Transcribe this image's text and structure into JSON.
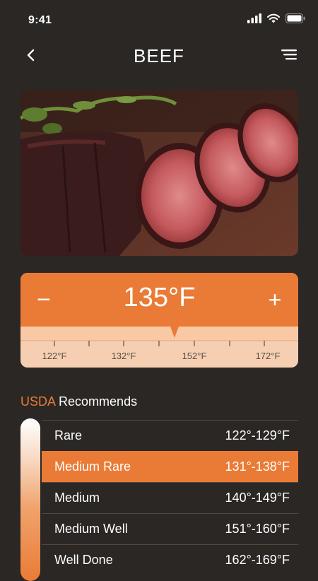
{
  "status": {
    "time": "9:41"
  },
  "nav": {
    "title": "BEEF"
  },
  "temperature": {
    "value": "135°F",
    "minus": "−",
    "plus": "+"
  },
  "ruler": {
    "labels": [
      "122°F",
      "132°F",
      "152°F",
      "172°F"
    ]
  },
  "section": {
    "accent": "USDA",
    "title": " Recommends"
  },
  "levels": [
    {
      "name": "Rare",
      "range": "122°-129°F"
    },
    {
      "name": "Medium Rare",
      "range": "131°-138°F"
    },
    {
      "name": "Medium",
      "range": "140°-149°F"
    },
    {
      "name": "Medium Well",
      "range": "151°-160°F"
    },
    {
      "name": "Well Done",
      "range": "162°-169°F"
    }
  ],
  "active_level": "Medium Rare",
  "colors": {
    "accent": "#ea7b36",
    "background": "#2a2725",
    "ruler_bg": "#f6cfb2"
  }
}
